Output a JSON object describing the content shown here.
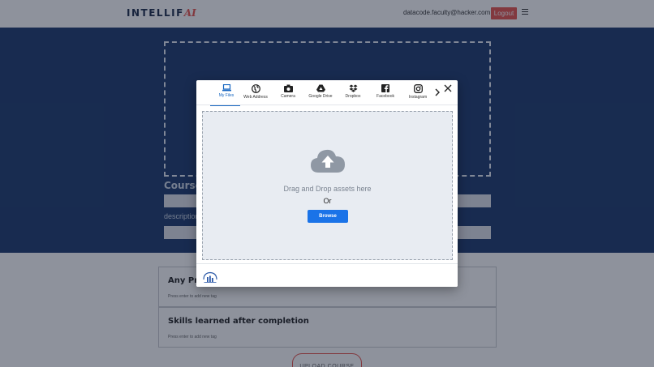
{
  "header": {
    "logo_text": "INTELLIF",
    "logo_accent": "AI",
    "user_email": "datacode.faculty@hacker.com",
    "logout_label": "Logout",
    "menu_icon": "hamburger-icon"
  },
  "hero": {
    "course_heading": "Course",
    "description_label": "description"
  },
  "cards": [
    {
      "title": "Any Pr",
      "hint": "Press enter to add new tag"
    },
    {
      "title": "Skills learned after completion",
      "hint": "Press enter to add new tag"
    }
  ],
  "upload_label": "UPLOAD COURSE",
  "picker": {
    "tabs": [
      {
        "label": "My Files",
        "icon": "laptop-icon",
        "active": true
      },
      {
        "label": "Web Address",
        "icon": "globe-icon"
      },
      {
        "label": "Camera",
        "icon": "camera-icon"
      },
      {
        "label": "Google Drive",
        "icon": "google-drive-icon"
      },
      {
        "label": "Dropbox",
        "icon": "dropbox-icon"
      },
      {
        "label": "Facebook",
        "icon": "facebook-icon"
      },
      {
        "label": "Instagram",
        "icon": "instagram-icon"
      }
    ],
    "more_icon": "chevron-right-icon",
    "close_icon": "close-icon",
    "drop_text": "Drag and Drop assets here",
    "or_text": "Or",
    "browse_label": "Browse",
    "footer_icon": "cloud-bars-logo-icon"
  },
  "colors": {
    "brand_navy": "#1d3a6e",
    "accent_red": "#e8554e",
    "active_tab": "#1565c0",
    "browse_blue": "#1a73e8"
  }
}
